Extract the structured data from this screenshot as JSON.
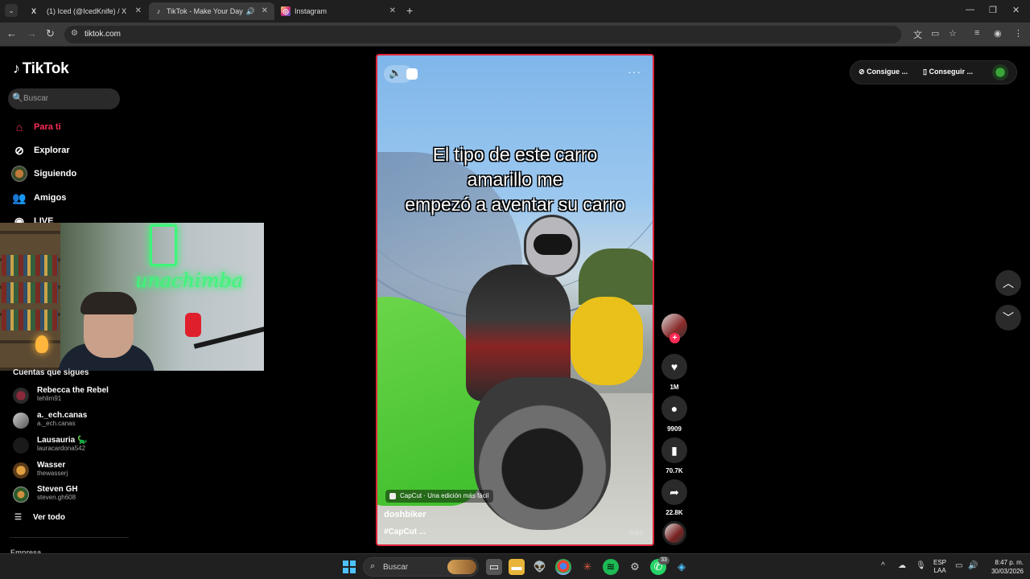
{
  "browser": {
    "tabs": [
      {
        "title": "(1) Iced (@IcedKnife) / X",
        "favicon": "X",
        "active": false
      },
      {
        "title": "TikTok - Make Your Day",
        "favicon": "♪",
        "active": true
      },
      {
        "title": "Instagram",
        "favicon": "◎",
        "active": false
      }
    ],
    "url": "tiktok.com"
  },
  "tiktok": {
    "logo": "TikTok",
    "search_placeholder": "Buscar",
    "nav": [
      {
        "label": "Para ti",
        "icon": "home-icon"
      },
      {
        "label": "Explorar",
        "icon": "compass-icon"
      },
      {
        "label": "Siguiendo",
        "icon": "following-icon"
      },
      {
        "label": "Amigos",
        "icon": "friends-icon"
      },
      {
        "label": "LIVE",
        "icon": "live-icon"
      }
    ],
    "following_title": "Cuentas que sigues",
    "following": [
      {
        "name": "Rebecca the Rebel",
        "username": "tehlim91"
      },
      {
        "name": "a._ech.canas",
        "username": "a._ech.canas"
      },
      {
        "name": "Lausauria 🦕",
        "username": "lauracardona542"
      },
      {
        "name": "Wasser",
        "username": "thewasserj"
      },
      {
        "name": "Steven GH",
        "username": "steven.gh608"
      }
    ],
    "see_all": "Ver todo",
    "company": "Empresa",
    "top_right": {
      "btn1": "Consigue ...",
      "btn2": "Conseguir ..."
    },
    "webcam_sign": "unachimba"
  },
  "video": {
    "caption_line1": "El tipo de este carro",
    "caption_line2": "amarillo me",
    "caption_line3": "empezó a aventar su carro",
    "capcut": "CapCut · Una edición más fácil",
    "author": "doshbiker",
    "tags": "#CapCut ...",
    "more": "más",
    "likes": "1M",
    "comments": "9909",
    "saves": "70.7K",
    "shares": "22.8K"
  },
  "taskbar": {
    "search": "Buscar",
    "whatsapp_badge": "33",
    "lang": "ESP",
    "region": "LAA",
    "time": "8:47 p. m.",
    "date": "30/03/2026"
  }
}
